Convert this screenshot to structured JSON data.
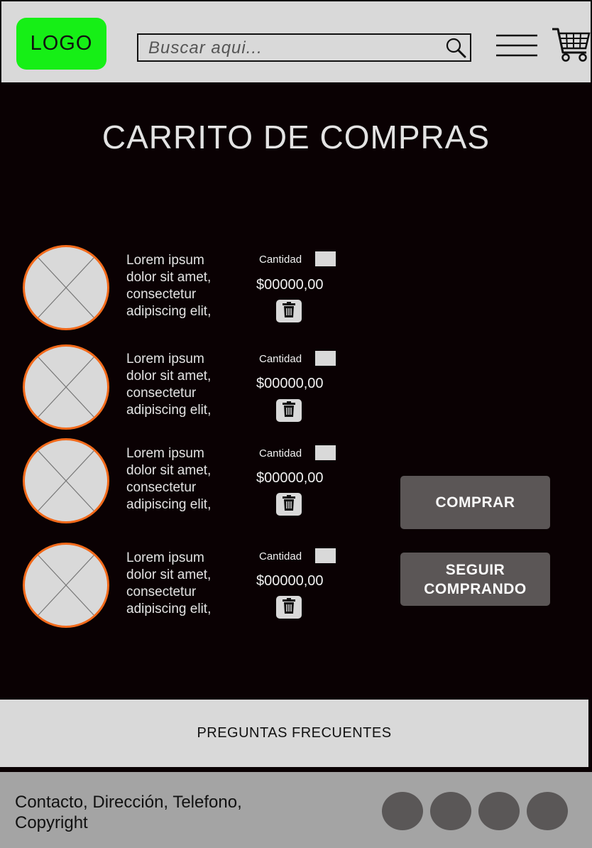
{
  "header": {
    "logo_text": "LOGO",
    "search_placeholder": "Buscar  aqui..."
  },
  "page_title": "CARRITO DE COMPRAS",
  "cart_items": [
    {
      "description": "Lorem ipsum\ndolor sit amet,\nconsectetur\nadipiscing elit,",
      "qty_label": "Cantidad",
      "price": "$00000,00"
    },
    {
      "description": "Lorem ipsum\ndolor sit amet,\nconsectetur\nadipiscing elit,",
      "qty_label": "Cantidad",
      "price": "$00000,00"
    },
    {
      "description": "Lorem ipsum\ndolor sit amet,\nconsectetur\nadipiscing elit,",
      "qty_label": "Cantidad",
      "price": "$00000,00"
    },
    {
      "description": "Lorem ipsum\ndolor sit amet,\nconsectetur\nadipiscing elit,",
      "qty_label": "Cantidad",
      "price": "$00000,00"
    }
  ],
  "buttons": {
    "buy": "COMPRAR",
    "continue_line1": "SEGUIR",
    "continue_line2": "COMPRANDO"
  },
  "faq_label": "PREGUNTAS FRECUENTES",
  "footer": {
    "text": "Contacto, Dirección, Telefono, Copyright"
  },
  "colors": {
    "accent_logo": "#16ef16",
    "thumb_border": "#f26a1b",
    "background": "#0a0103"
  },
  "icons": [
    "search-icon",
    "menu-icon",
    "cart-icon",
    "trash-icon"
  ]
}
